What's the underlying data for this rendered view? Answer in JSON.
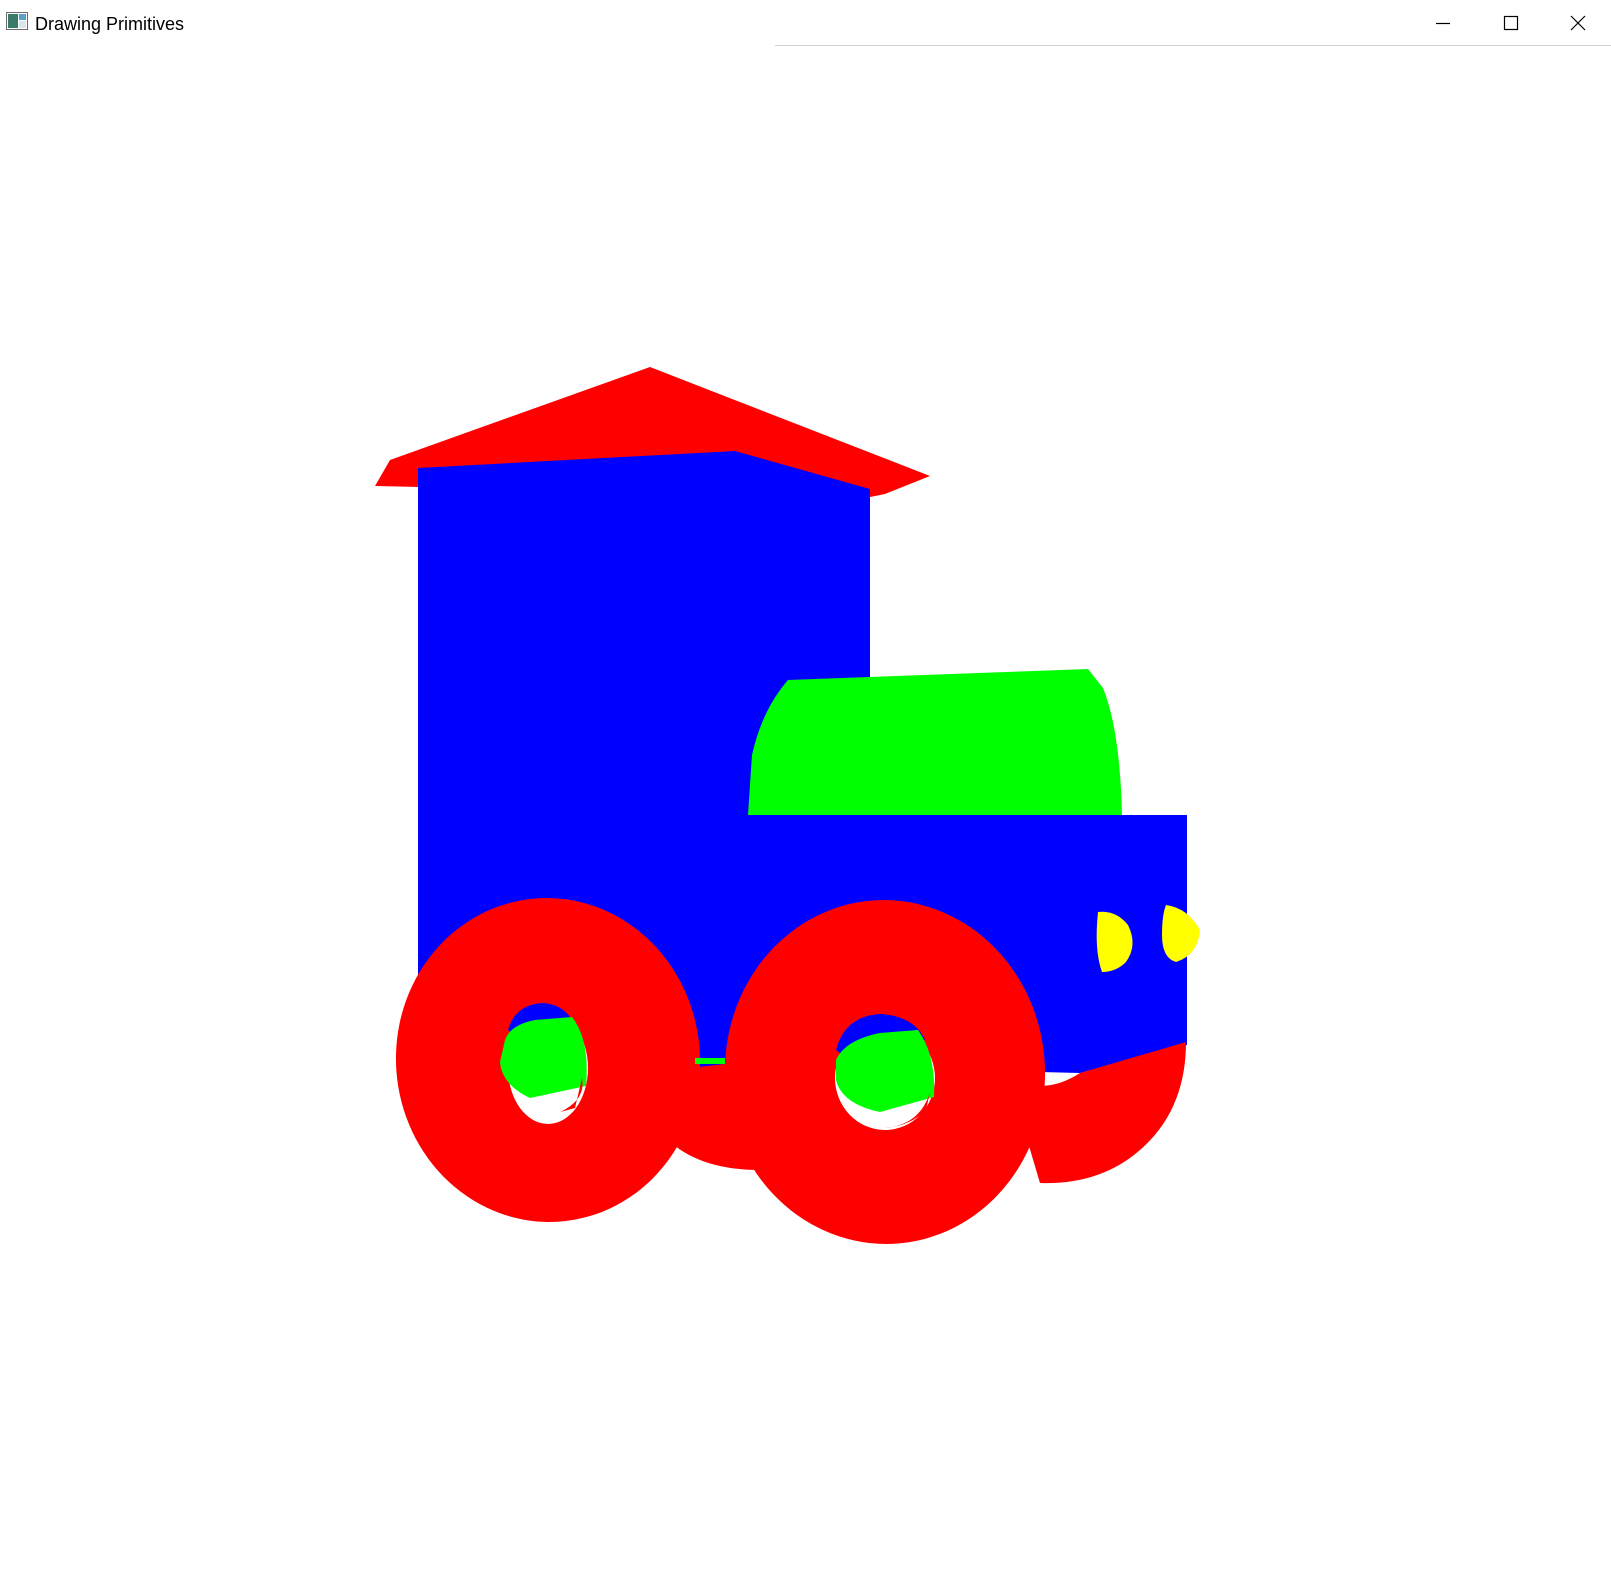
{
  "window": {
    "title": "Drawing Primitives",
    "controls": {
      "minimize_icon": "minimize-icon",
      "maximize_icon": "maximize-icon",
      "close_icon": "close-icon"
    }
  },
  "scene": {
    "background": "#ffffff",
    "colors": {
      "red": "#ff0000",
      "blue": "#0000ff",
      "green": "#00ff00",
      "yellow": "#ffff00"
    }
  }
}
